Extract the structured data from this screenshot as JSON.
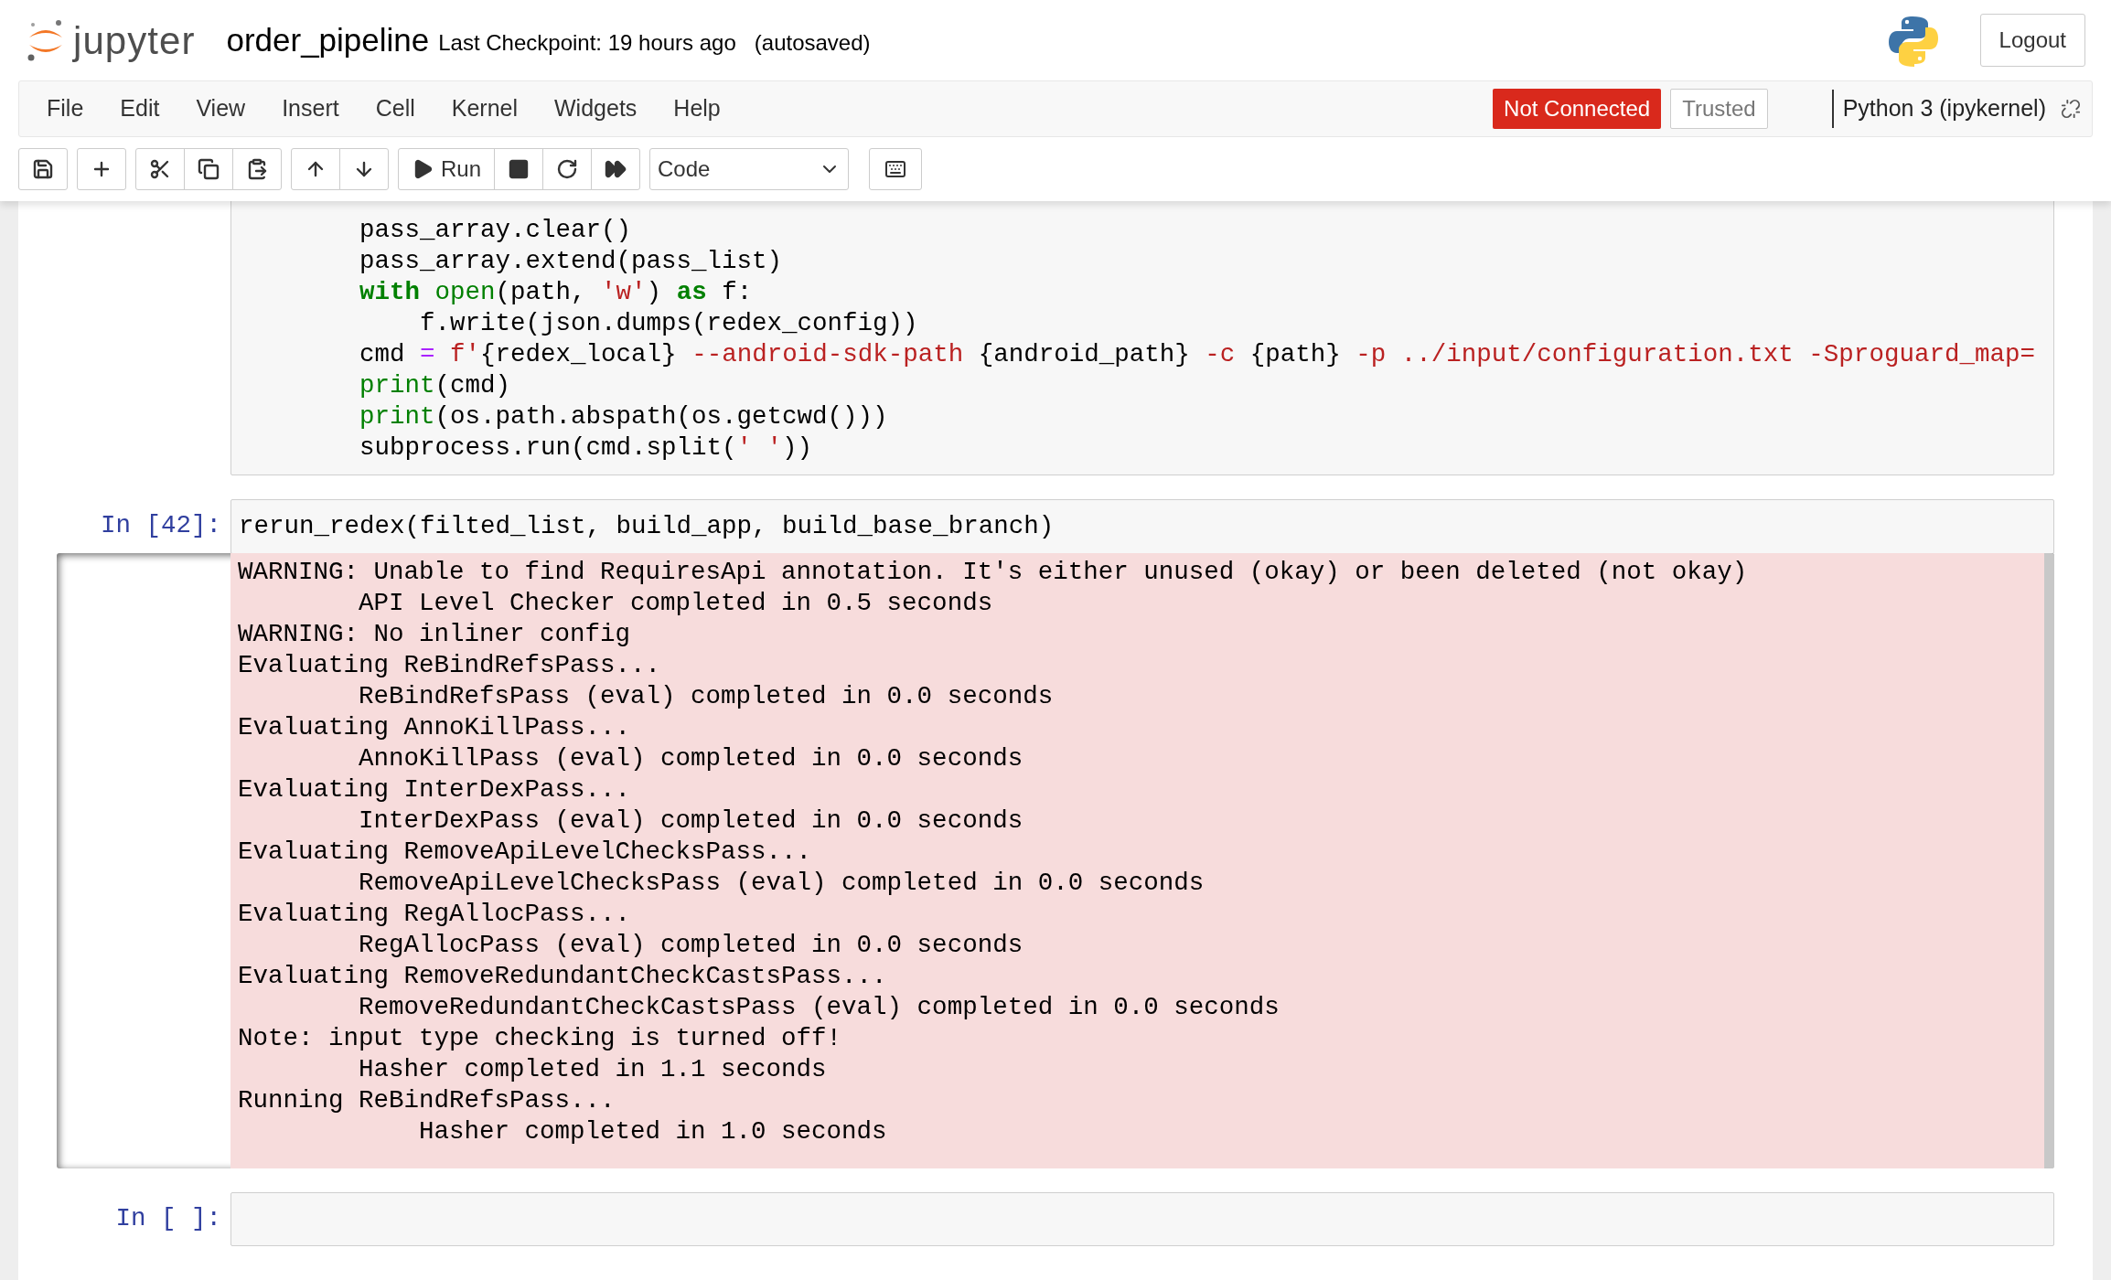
{
  "header": {
    "logo_text": "jupyter",
    "notebook_name": "order_pipeline",
    "checkpoint": "Last Checkpoint: 19 hours ago",
    "autosave": "(autosaved)",
    "logout": "Logout"
  },
  "menu": [
    "File",
    "Edit",
    "View",
    "Insert",
    "Cell",
    "Kernel",
    "Widgets",
    "Help"
  ],
  "kernel_status": {
    "connection": "Not Connected",
    "trusted": "Trusted",
    "kernel": "Python 3 (ipykernel)"
  },
  "toolbar": {
    "groups": [
      [
        {
          "kind": "save"
        }
      ],
      [
        {
          "kind": "add"
        }
      ],
      [
        {
          "kind": "cut"
        },
        {
          "kind": "copy"
        },
        {
          "kind": "paste"
        }
      ],
      [
        {
          "kind": "up"
        },
        {
          "kind": "down"
        }
      ],
      [
        {
          "kind": "run",
          "label": "Run"
        },
        {
          "kind": "stop"
        },
        {
          "kind": "restart"
        },
        {
          "kind": "runall"
        }
      ]
    ],
    "cell_type": "Code"
  },
  "cells": [
    {
      "lines": [
        [
          {
            "t": "        pass_array.clear()",
            "kind": "plain"
          }
        ],
        [
          {
            "t": "        pass_array.extend(pass_list)",
            "kind": "plain"
          }
        ],
        [
          {
            "t": "        with",
            "kind": "kw"
          },
          {
            "t": " open",
            "kind": "builtin"
          },
          {
            "t": "(path, ",
            "kind": "plain"
          },
          {
            "t": "'w'",
            "kind": "str"
          },
          {
            "t": ") ",
            "kind": "plain"
          },
          {
            "t": "as",
            "kind": "kw"
          },
          {
            "t": " f:",
            "kind": "plain"
          }
        ],
        [
          {
            "t": "            f.write(json.dumps(redex_config))",
            "kind": "plain"
          }
        ],
        [
          {
            "t": "        cmd ",
            "kind": "plain"
          },
          {
            "t": "=",
            "kind": "op"
          },
          {
            "t": " f'",
            "kind": "str"
          },
          {
            "t": "{redex_local}",
            "kind": "plain"
          },
          {
            "t": " --android-sdk-path ",
            "kind": "str"
          },
          {
            "t": "{android_path}",
            "kind": "plain"
          },
          {
            "t": " -c ",
            "kind": "str"
          },
          {
            "t": "{path}",
            "kind": "plain"
          },
          {
            "t": " -p ../input/configuration.txt -Sproguard_map=",
            "kind": "str"
          }
        ],
        [
          {
            "t": "        print",
            "kind": "builtin"
          },
          {
            "t": "(cmd)",
            "kind": "plain"
          }
        ],
        [
          {
            "t": "        print",
            "kind": "builtin"
          },
          {
            "t": "(os.path.abspath(os.getcwd()))",
            "kind": "plain"
          }
        ],
        [
          {
            "t": "        subprocess.run(cmd.split(",
            "kind": "plain"
          },
          {
            "t": "' '",
            "kind": "str"
          },
          {
            "t": "))",
            "kind": "plain"
          }
        ]
      ]
    },
    {
      "prompt": "In [42]:",
      "lines": [
        [
          {
            "t": "rerun_redex(filted_list, build_app, build_base_branch)",
            "kind": "plain"
          }
        ]
      ],
      "output": {
        "kind": "stderr",
        "lines": [
          "WARNING: Unable to find RequiresApi annotation. It's either unused (okay) or been deleted (not okay)",
          "        API Level Checker completed in 0.5 seconds",
          "WARNING: No inliner config",
          "Evaluating ReBindRefsPass...",
          "        ReBindRefsPass (eval) completed in 0.0 seconds",
          "Evaluating AnnoKillPass...",
          "        AnnoKillPass (eval) completed in 0.0 seconds",
          "Evaluating InterDexPass...",
          "        InterDexPass (eval) completed in 0.0 seconds",
          "Evaluating RemoveApiLevelChecksPass...",
          "        RemoveApiLevelChecksPass (eval) completed in 0.0 seconds",
          "Evaluating RegAllocPass...",
          "        RegAllocPass (eval) completed in 0.0 seconds",
          "Evaluating RemoveRedundantCheckCastsPass...",
          "        RemoveRedundantCheckCastsPass (eval) completed in 0.0 seconds",
          "Note: input type checking is turned off!",
          "        Hasher completed in 1.1 seconds",
          "Running ReBindRefsPass...",
          "            Hasher completed in 1.0 seconds"
        ]
      }
    },
    {
      "prompt": "In [ ]:"
    }
  ]
}
